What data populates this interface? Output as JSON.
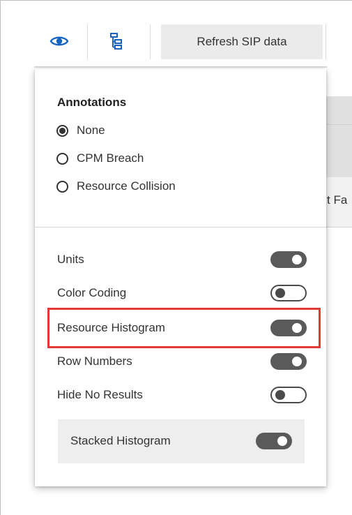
{
  "toolbar": {
    "visibility_icon": "eye-icon",
    "hierarchy_icon": "hierarchy-tree-icon",
    "refresh_label": "Refresh SIP data"
  },
  "background": {
    "row_text_fragment": "t Fa"
  },
  "popup": {
    "annotations": {
      "title": "Annotations",
      "options": [
        {
          "label": "None",
          "selected": true
        },
        {
          "label": "CPM Breach",
          "selected": false
        },
        {
          "label": "Resource Collision",
          "selected": false
        }
      ]
    },
    "toggles": [
      {
        "label": "Units",
        "on": true
      },
      {
        "label": "Color Coding",
        "on": false
      },
      {
        "label": "Resource Histogram",
        "on": true,
        "highlighted": true
      },
      {
        "label": "Row Numbers",
        "on": true
      },
      {
        "label": "Hide No Results",
        "on": false
      }
    ],
    "stacked": {
      "label": "Stacked Histogram",
      "on": true
    }
  },
  "colors": {
    "toggle_on": "#5a5a5a",
    "highlight": "#e53935",
    "button_bg": "#ebebeb"
  }
}
